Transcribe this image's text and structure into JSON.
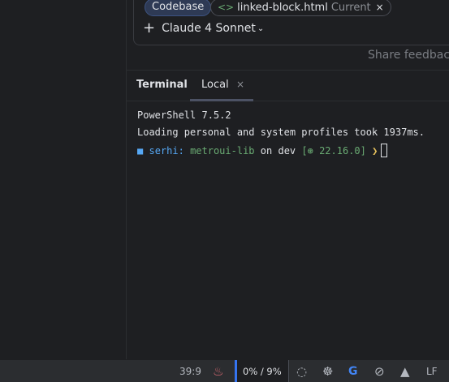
{
  "chat": {
    "context_chips": [
      {
        "label": "Codebase"
      },
      {
        "icon": "<>",
        "label": "linked-block.html",
        "badge": "Current",
        "close": "×"
      }
    ],
    "model_add": "+",
    "model_label": "Claude 4 Sonnet",
    "model_chevron": "⌄",
    "share_feedback": "Share feedback"
  },
  "terminal": {
    "title": "Terminal",
    "tabs": [
      {
        "label": "Local",
        "close": "×"
      }
    ],
    "lines": {
      "l1": "PowerShell 7.5.2",
      "l2": "Loading personal and system profiles took 1937ms.",
      "prompt": {
        "marker": "■",
        "user": "serhi:",
        "dir": "metroui-lib",
        "on": "on",
        "branch": "dev",
        "node": "[⊛ 22.16.0]",
        "arrow": "❯"
      }
    }
  },
  "status_bar": {
    "position": "39:9",
    "memory": "0% /  9%",
    "line_ending": "LF",
    "icons": [
      "java-icon",
      "copilot-icon",
      "ai-assistant-icon",
      "google-icon",
      "no-inspections-icon",
      "code-with-me-icon"
    ]
  },
  "colors": {
    "accent": "#3574f0",
    "background": "#1e1f22",
    "panel": "#2b2d30",
    "green": "#6aab73",
    "blue": "#56a8f5",
    "yellow": "#e8c35d"
  }
}
